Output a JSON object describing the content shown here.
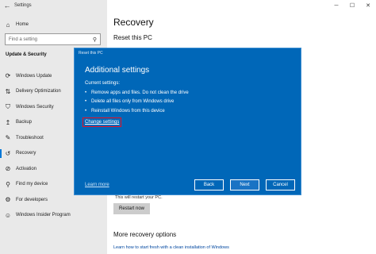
{
  "window": {
    "title": "Settings",
    "minimize_icon": "minimize-icon",
    "maximize_icon": "maximize-icon",
    "close_icon": "close-icon"
  },
  "sidebar": {
    "home": "Home",
    "search_placeholder": "Find a setting",
    "section": "Update & Security",
    "items": [
      {
        "label": "Windows Update",
        "icon": "sync-icon",
        "glyph": "⟳"
      },
      {
        "label": "Delivery Optimization",
        "icon": "delivery-optimization-icon",
        "glyph": "⇅"
      },
      {
        "label": "Windows Security",
        "icon": "shield-icon",
        "glyph": "⛉"
      },
      {
        "label": "Backup",
        "icon": "backup-icon",
        "glyph": "↥"
      },
      {
        "label": "Troubleshoot",
        "icon": "wrench-icon",
        "glyph": "✎"
      },
      {
        "label": "Recovery",
        "icon": "recovery-icon",
        "glyph": "↺",
        "active": true
      },
      {
        "label": "Activation",
        "icon": "activation-icon",
        "glyph": "⊘"
      },
      {
        "label": "Find my device",
        "icon": "person-location-icon",
        "glyph": "⚲"
      },
      {
        "label": "For developers",
        "icon": "developer-icon",
        "glyph": "⚙"
      },
      {
        "label": "Windows Insider Program",
        "icon": "insider-icon",
        "glyph": "☺"
      }
    ]
  },
  "main": {
    "title": "Recovery",
    "subtitle": "Reset this PC",
    "partial_text": "This will restart your PC.",
    "restart_button": "Restart now",
    "more_title": "More recovery options",
    "more_link": "Learn how to start fresh with a clean installation of Windows"
  },
  "dialog": {
    "window_title": "Reset this PC",
    "heading": "Additional settings",
    "current_label": "Current settings:",
    "bullets": [
      "Remove apps and files. Do not clean the drive",
      "Delete all files only from Windows drive",
      "Reinstall Windows from this device"
    ],
    "change_link": "Change settings",
    "learn_more": "Learn more",
    "back": "Back",
    "next": "Next",
    "cancel": "Cancel"
  },
  "colors": {
    "dialog_bg": "#0067b8",
    "accent": "#0078d7",
    "highlight_border": "#e81123",
    "sidebar_bg": "#e9e9e9"
  }
}
